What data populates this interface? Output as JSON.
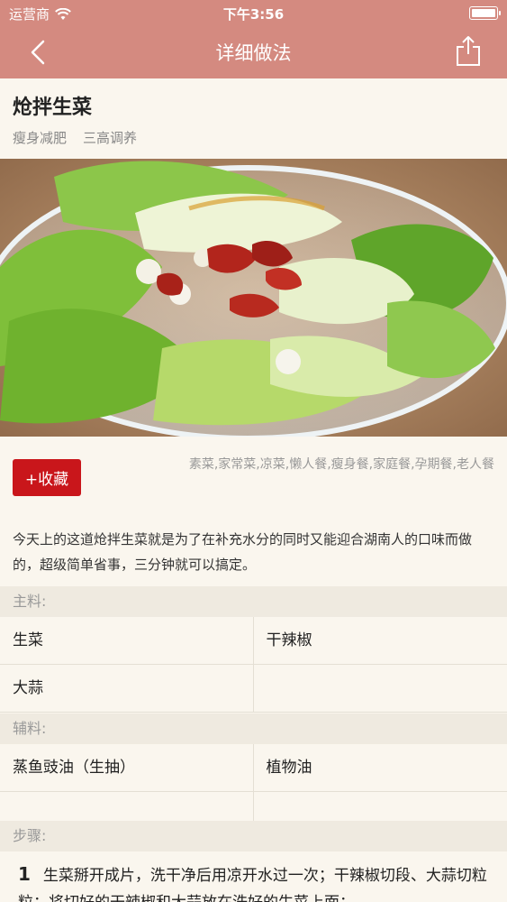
{
  "status_bar": {
    "carrier": "运营商",
    "time": "下午3:56"
  },
  "nav": {
    "title": "详细做法"
  },
  "recipe": {
    "name": "炝拌生菜",
    "tags": [
      "瘦身减肥",
      "三高调养"
    ],
    "collect_label": "+收藏",
    "categories": "素菜,家常菜,凉菜,懒人餐,瘦身餐,家庭餐,孕期餐,老人餐",
    "intro": "今天上的这道炝拌生菜就是为了在补充水分的同时又能迎合湖南人的口味而做的，超级简单省事，三分钟就可以搞定。"
  },
  "main_ingredients": {
    "title": "主料:",
    "rows": [
      [
        "生菜",
        "干辣椒"
      ],
      [
        "大蒜",
        ""
      ]
    ]
  },
  "aux_ingredients": {
    "title": "辅料:",
    "rows": [
      [
        "蒸鱼豉油（生抽）",
        "植物油"
      ],
      [
        "",
        ""
      ]
    ]
  },
  "steps": {
    "title": "步骤:",
    "items": [
      {
        "num": "1",
        "text": "生菜掰开成片，洗干净后用凉开水过一次；干辣椒切段、大蒜切粒粒；将切好的干辣椒和大蒜放在洗好的生菜上面；"
      }
    ]
  },
  "icons": {
    "back": "chevron-left-icon",
    "share": "share-icon",
    "wifi": "wifi-icon",
    "battery": "battery-icon"
  }
}
